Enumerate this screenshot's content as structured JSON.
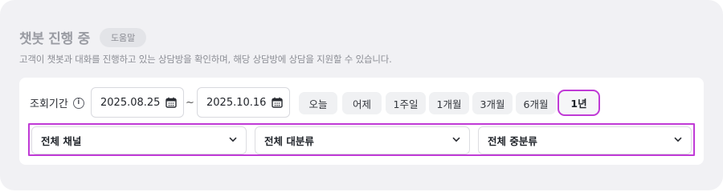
{
  "header": {
    "title": "챗봇 진행 중",
    "help_badge": "도움말",
    "description": "고객이 챗봇과 대화를 진행하고 있는 상담방을 확인하며, 해당 상담방에 상담을 지원할 수 있습니다."
  },
  "period": {
    "label": "조회기간",
    "info_icon": "info-circle-icon",
    "start_date": "2025.08.25",
    "end_date": "2025.10.16",
    "separator": "~",
    "calendar_icon": "calendar-icon",
    "quick_ranges": [
      {
        "label": "오늘"
      },
      {
        "label": "어제"
      },
      {
        "label": "1주일"
      },
      {
        "label": "1개월"
      },
      {
        "label": "3개월"
      },
      {
        "label": "6개월"
      },
      {
        "label": "1년",
        "active": true
      }
    ]
  },
  "filters": {
    "channel": "전체 채널",
    "category_major": "전체 대분류",
    "category_mid": "전체 중분류",
    "chevron_icon": "chevron-down-icon"
  },
  "colors": {
    "panel_bg": "#f1f1f4",
    "highlight": "#c03ad6"
  }
}
